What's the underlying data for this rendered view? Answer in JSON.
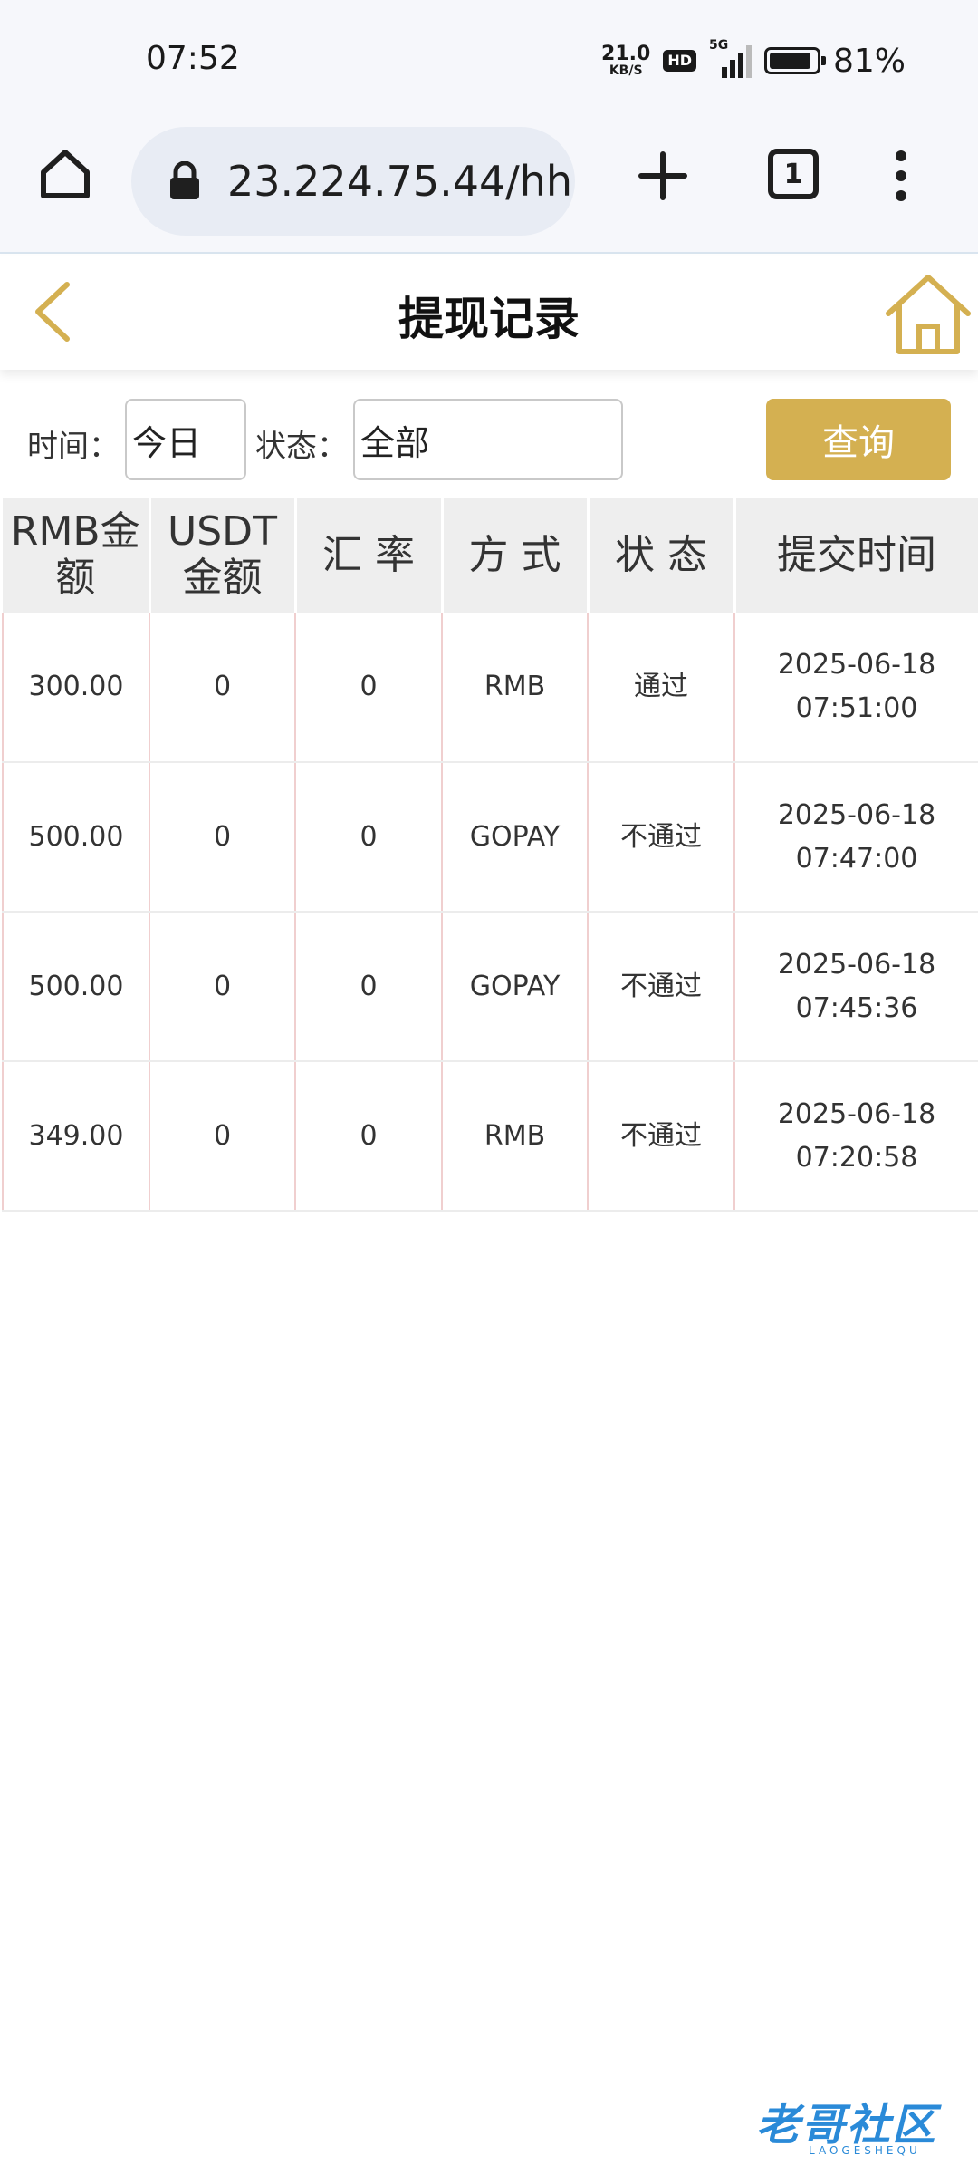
{
  "status_bar": {
    "time": "07:52",
    "net_speed_value": "21.0",
    "net_speed_unit": "KB/S",
    "hd_label": "HD",
    "network_label": "5G",
    "battery_percent": "81%"
  },
  "browser": {
    "url": "23.224.75.44/hh",
    "tab_count": "1",
    "icons": [
      "home-icon",
      "lock-icon",
      "plus-icon",
      "tabs-icon",
      "more-vertical-icon"
    ]
  },
  "header": {
    "title": "提现记录",
    "icons": [
      "back-arrow-icon",
      "home-icon"
    ],
    "accent_color": "#d4b051"
  },
  "filter": {
    "time_label": "时间：",
    "time_value": "今日",
    "status_label": "状态：",
    "status_value": "全部",
    "query_button": "查询"
  },
  "table": {
    "headers": [
      "RMB金额",
      "USDT金额",
      "汇 率",
      "方 式",
      "状 态",
      "提交时间"
    ],
    "rows": [
      [
        "300.00",
        "0",
        "0",
        "RMB",
        "通过",
        "2025-06-18",
        "07:51:00"
      ],
      [
        "500.00",
        "0",
        "0",
        "GOPAY",
        "不通过",
        "2025-06-18",
        "07:47:00"
      ],
      [
        "500.00",
        "0",
        "0",
        "GOPAY",
        "不通过",
        "2025-06-18",
        "07:45:36"
      ],
      [
        "349.00",
        "0",
        "0",
        "RMB",
        "不通过",
        "2025-06-18",
        "07:20:58"
      ]
    ]
  },
  "watermark": {
    "text": "老哥社区",
    "sub": "LAOGESHEQU"
  }
}
